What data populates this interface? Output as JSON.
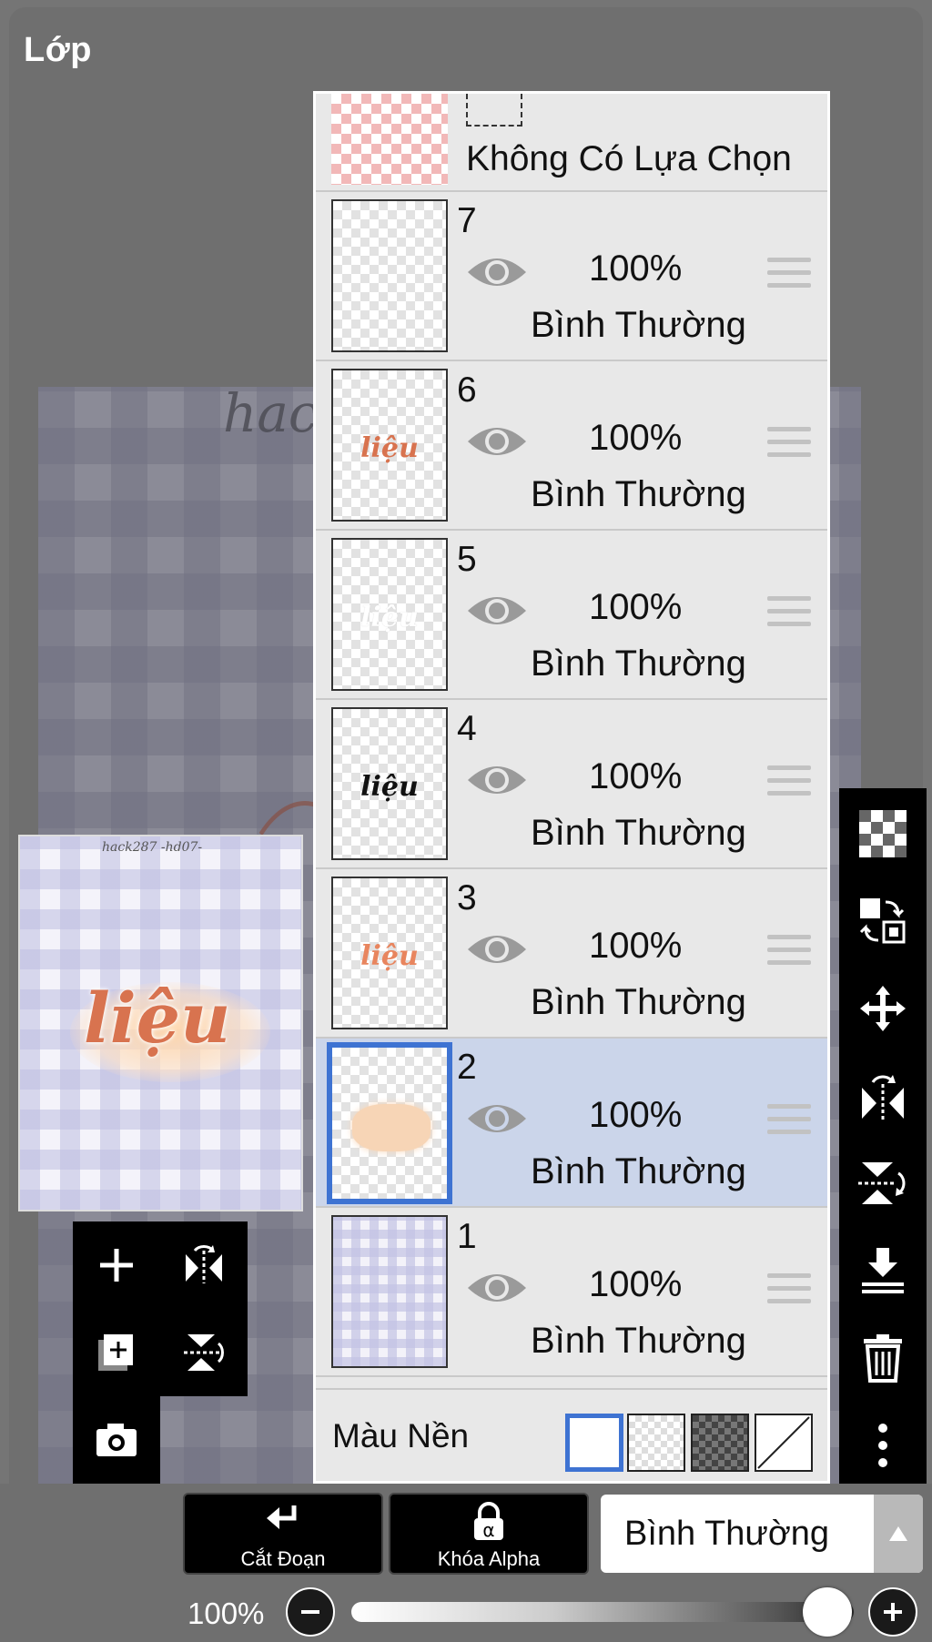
{
  "header": {
    "title": "Lớp"
  },
  "canvas": {
    "background_handle": "hack",
    "preview_handle": "hack287 -hd07-",
    "preview_word": "liệu"
  },
  "selection": {
    "label": "Không Có Lựa Chọn"
  },
  "layers": [
    {
      "number": "7",
      "opacity": "100%",
      "blend": "Bình Thường",
      "content": "empty",
      "selected": false
    },
    {
      "number": "6",
      "opacity": "100%",
      "blend": "Bình Thường",
      "content": "liệu",
      "content_color": "#d8734f",
      "selected": false
    },
    {
      "number": "5",
      "opacity": "100%",
      "blend": "Bình Thường",
      "content": "liệu",
      "content_color": "#ffffff",
      "selected": false
    },
    {
      "number": "4",
      "opacity": "100%",
      "blend": "Bình Thường",
      "content": "liệu",
      "content_color": "#111111",
      "selected": false
    },
    {
      "number": "3",
      "opacity": "100%",
      "blend": "Bình Thường",
      "content": "liệu",
      "content_color": "#e8855e",
      "selected": false
    },
    {
      "number": "2",
      "opacity": "100%",
      "blend": "Bình Thường",
      "content": "glow-blob",
      "selected": true
    },
    {
      "number": "1",
      "opacity": "100%",
      "blend": "Bình Thường",
      "content": "plaid",
      "selected": false
    }
  ],
  "background_color": {
    "label": "Màu Nền",
    "options": [
      "white",
      "transparent-light",
      "transparent-dark",
      "none"
    ],
    "selected": "white"
  },
  "left_tools": [
    "plus-icon",
    "flip-horizontal-icon",
    "duplicate-layer-icon",
    "flip-vertical-icon",
    "camera-icon"
  ],
  "right_toolbar": [
    "transparency-icon",
    "swap-icon",
    "move-icon",
    "flip-horizontal-icon",
    "flip-vertical-icon",
    "merge-down-icon",
    "trash-icon",
    "more-icon"
  ],
  "bottom": {
    "cut_label": "Cắt Đoạn",
    "alpha_label": "Khóa Alpha",
    "blend_mode": "Bình Thường",
    "opacity_label": "100%",
    "opacity_value": 1.0
  },
  "colors": {
    "accent": "#3e73d2",
    "selected_row": "#cbd5ea",
    "panel_bg": "#e8e8e8"
  }
}
